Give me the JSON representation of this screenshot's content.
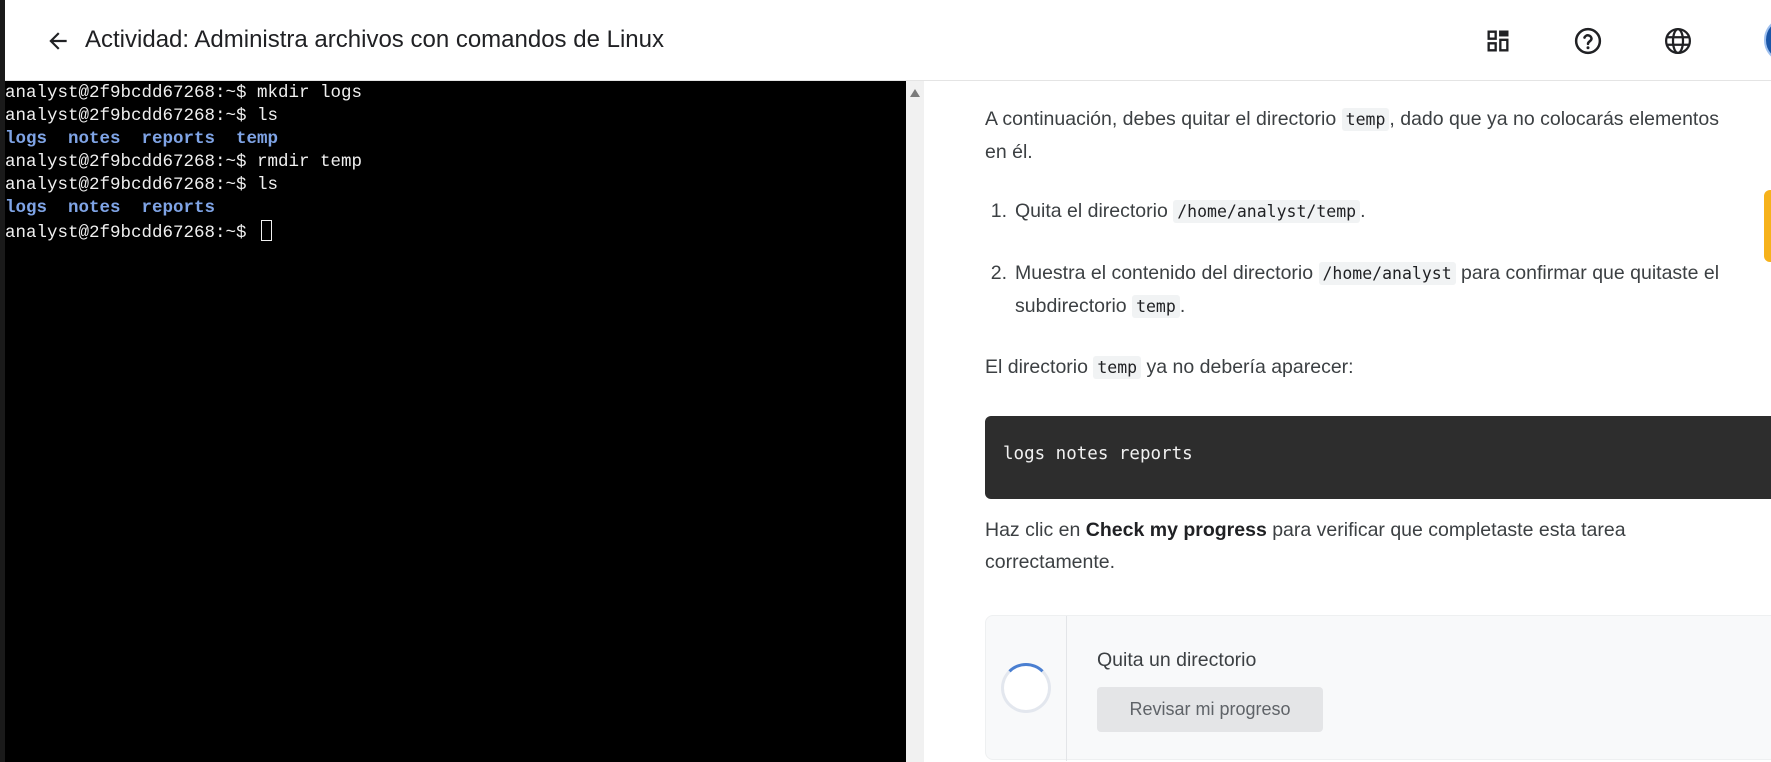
{
  "header": {
    "back_label": "←",
    "title": "Actividad: Administra archivos con comandos de Linux",
    "icons": [
      "back-arrow-icon",
      "dashboard-icon",
      "help-icon",
      "language-globe-icon"
    ]
  },
  "terminal": {
    "lines": [
      {
        "prompt": "analyst@2f9bcdd67268:~$ ",
        "command": "mkdir logs"
      },
      {
        "prompt": "analyst@2f9bcdd67268:~$ ",
        "command": "ls"
      },
      {
        "dirs": [
          "logs",
          "notes",
          "reports",
          "temp"
        ]
      },
      {
        "prompt": "analyst@2f9bcdd67268:~$ ",
        "command": "rmdir temp"
      },
      {
        "prompt": "analyst@2f9bcdd67268:~$ ",
        "command": "ls"
      },
      {
        "dirs": [
          "logs",
          "notes",
          "reports"
        ]
      },
      {
        "prompt": "analyst@2f9bcdd67268:~$ ",
        "command": ""
      }
    ],
    "text_color": "#f0f0f0",
    "dir_color": "#7fa4e6"
  },
  "instructions": {
    "intro_before": "A continuación, debes quitar el directorio ",
    "intro_code": "temp",
    "intro_after": ", dado que ya no colocarás elementos en él.",
    "step1_num": "1.",
    "step1_before": "Quita el directorio ",
    "step1_code": "/home/analyst/temp",
    "step1_after": ".",
    "step2_num": "2.",
    "step2_before": "Muestra el contenido del directorio ",
    "step2_code": "/home/analyst",
    "step2_mid": " para confirmar que quitaste el subdirectorio ",
    "step2_code2": "temp",
    "step2_after": ".",
    "note_before": "El directorio ",
    "note_code": "temp",
    "note_after": " ya no debería aparecer:",
    "code_block": "logs notes reports",
    "check_before": "Haz clic en ",
    "check_strong": "Check my progress",
    "check_after": " para verificar que completaste esta tarea correctamente."
  },
  "task": {
    "title": "Quita un directorio",
    "button_label": "Revisar mi progreso"
  },
  "colors": {
    "terminal_bg": "#000000",
    "code_block_bg": "#2d2d2d",
    "accent_tab": "#f6b21b",
    "avatar": "#1a56a8"
  }
}
